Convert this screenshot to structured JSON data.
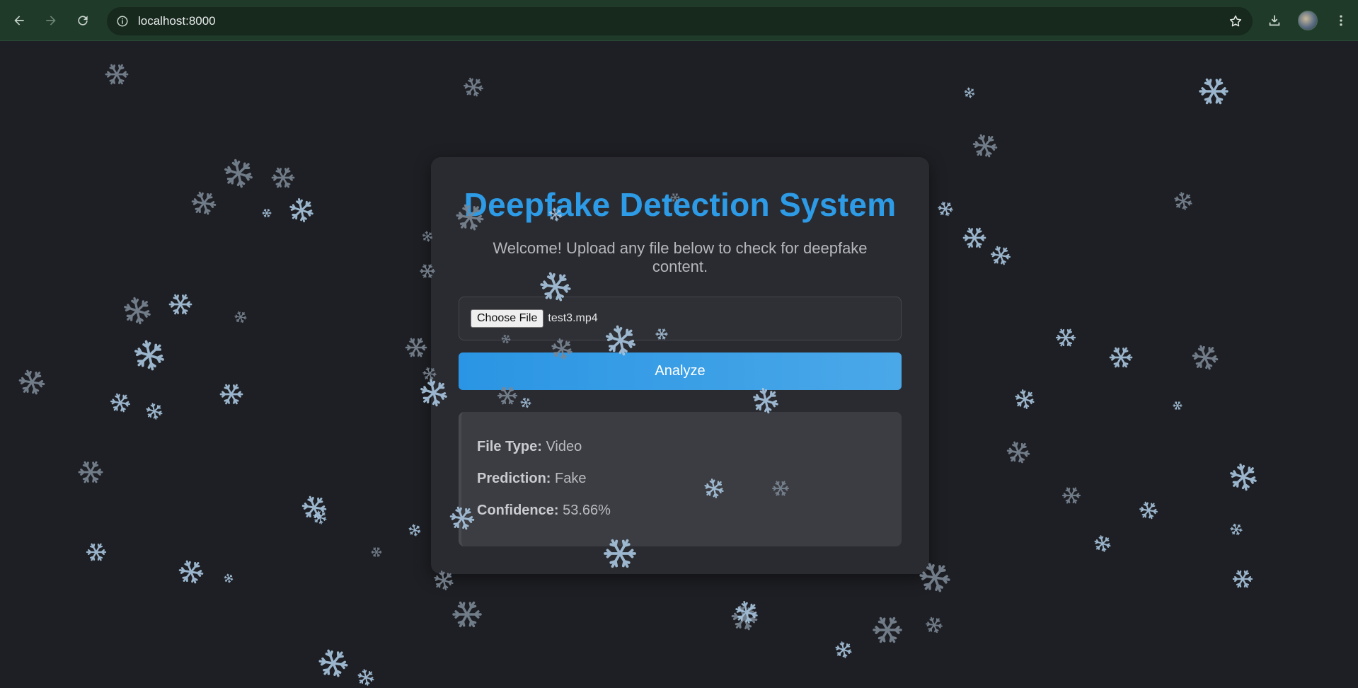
{
  "browser": {
    "url": "localhost:8000",
    "icons": {
      "back": "arrow-left-icon",
      "forward": "arrow-right-icon",
      "reload": "reload-icon",
      "site_info": "info-icon",
      "bookmark": "star-icon",
      "downloads": "download-icon",
      "profile": "avatar",
      "menu": "kebab-menu-icon"
    }
  },
  "app": {
    "title": "Deepfake Detection System",
    "subtitle": "Welcome! Upload any file below to check for deepfake content.",
    "file_input": {
      "button_label": "Choose File",
      "file_name": "test3.mp4"
    },
    "analyze_label": "Analyze",
    "results": {
      "file_type_label": "File Type:",
      "file_type_value": "Video",
      "prediction_label": "Prediction:",
      "prediction_value": "Fake",
      "confidence_label": "Confidence:",
      "confidence_value": "53.66%"
    }
  },
  "colors": {
    "background": "#1e1f24",
    "card": "#2a2b31",
    "title": "#2d9be6",
    "button": "#2a95e4",
    "chrome": "#1f3a29"
  },
  "decoration": {
    "background_icon": "snowflake-icon"
  }
}
